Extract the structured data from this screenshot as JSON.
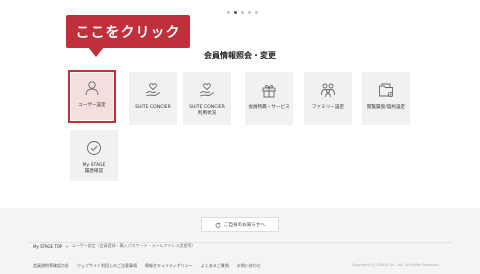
{
  "pager": {
    "count": 5,
    "active_index": 1
  },
  "callout": {
    "text": "ここをクリック",
    "color": "#c0303b"
  },
  "section": {
    "title": "会員情報照会・変更"
  },
  "tiles": [
    {
      "label": "ユーザー設定",
      "icon": "user-icon",
      "selected": true
    },
    {
      "label": "SUITE CONCIER",
      "icon": "hand-heart-icon"
    },
    {
      "label": "SUITE CONCIER\n利用状況",
      "icon": "hand-heart-icon"
    },
    {
      "label": "会員特典・サービス",
      "icon": "gift-icon"
    },
    {
      "label": "ファミリー設定",
      "icon": "family-icon"
    },
    {
      "label": "閲覧履歴/契約設定",
      "icon": "folder-icon"
    },
    {
      "label": "My STAGE\n履歴確認",
      "icon": "check-circle-icon"
    }
  ],
  "notice_button": {
    "label": "ご自身のお知らせへ",
    "icon": "refresh-icon"
  },
  "breadcrumb": {
    "home": "My STAGE TOP",
    "current": "ユーザー設定（会員登録・購入パスワード・メールアドレス変更等）"
  },
  "footer": {
    "links": [
      "会員規約等確認方針",
      "ウェブサイト利用上のご注意事項",
      "情報セキュリティポリシー",
      "よくあるご質問",
      "お問い合わせ"
    ],
    "copyright": "Copyright (C) STAGE Co., Ltd. All Rights Reserved."
  }
}
